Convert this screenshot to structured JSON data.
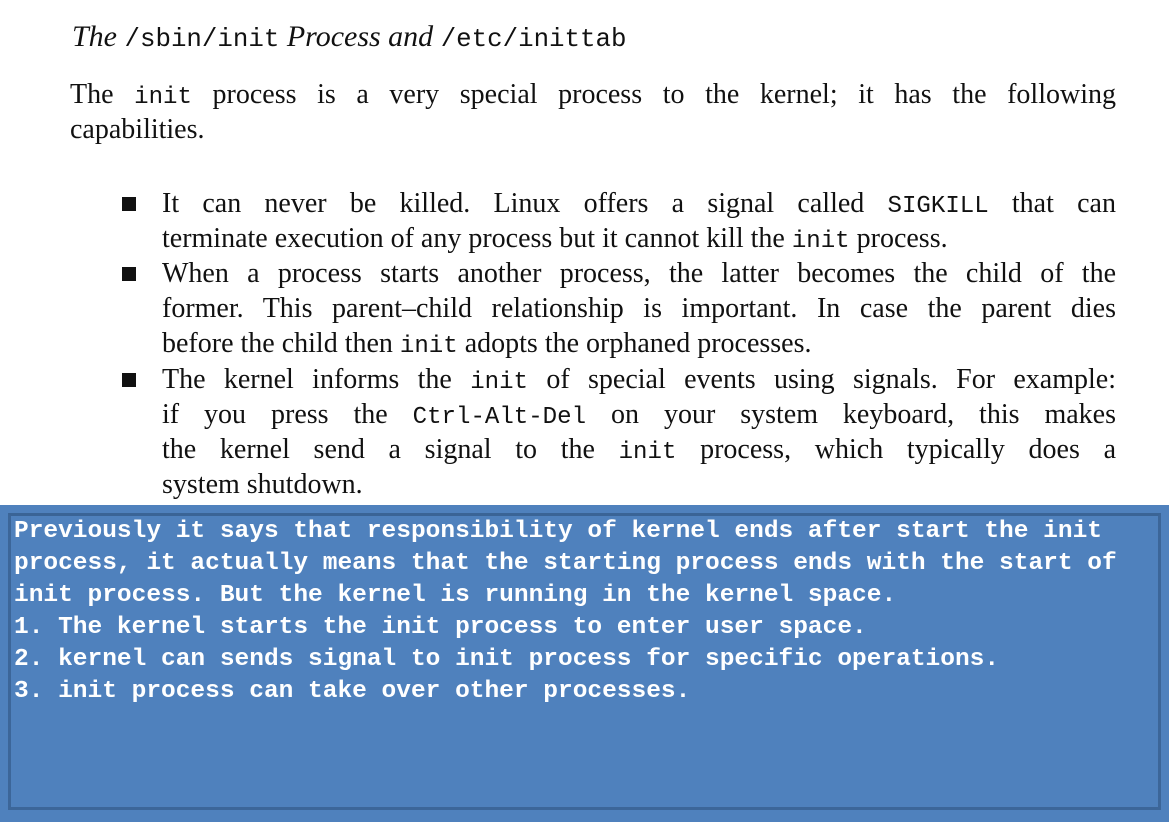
{
  "heading": [
    {
      "t": "The "
    },
    {
      "t": "/sbin/init",
      "code": true
    },
    {
      "t": " Process and "
    },
    {
      "t": "/etc/inittab",
      "code": true
    }
  ],
  "intro": [
    [
      {
        "t": "The "
      },
      {
        "t": "init",
        "code": true
      },
      {
        "t": " process is a very special process to the kernel; it has the following"
      }
    ],
    [
      {
        "t": "capabilities."
      }
    ]
  ],
  "bullets": [
    {
      "lines": [
        [
          {
            "t": "It can never be killed. Linux offers a signal called "
          },
          {
            "t": "SIGKILL",
            "code": true
          },
          {
            "t": " that can"
          }
        ],
        [
          {
            "t": "terminate execution of any process but it cannot kill the "
          },
          {
            "t": "init",
            "code": true
          },
          {
            "t": " process."
          }
        ]
      ]
    },
    {
      "lines": [
        [
          {
            "t": "When a process starts another process, the latter becomes the child of the"
          }
        ],
        [
          {
            "t": "former. This parent–child relationship is important. In case the parent dies"
          }
        ],
        [
          {
            "t": "before the child then "
          },
          {
            "t": "init",
            "code": true
          },
          {
            "t": " adopts the orphaned processes."
          }
        ]
      ]
    },
    {
      "lines": [
        [
          {
            "t": "The kernel informs the "
          },
          {
            "t": "init",
            "code": true
          },
          {
            "t": " of special events using signals. For example:"
          }
        ],
        [
          {
            "t": "if you press the "
          },
          {
            "t": "Ctrl-Alt-Del",
            "code": true
          },
          {
            "t": " on your system keyboard, this makes"
          }
        ],
        [
          {
            "t": "the kernel send a signal to the "
          },
          {
            "t": "init",
            "code": true
          },
          {
            "t": " process, which typically does a"
          }
        ],
        [
          {
            "t": "system shutdown."
          }
        ]
      ]
    }
  ],
  "note": {
    "lines": [
      "Previously it says that responsibility of kernel ends after start the init",
      "process, it actually means that the starting process ends with the start of",
      "init process. But the kernel is running in the kernel space.",
      "1. The kernel starts the init process to enter user space.",
      "2. kernel can sends signal to init process for specific operations.",
      "3. init process can take over other processes."
    ],
    "bg_color": "#4f81bd",
    "border_color": "#3a6496"
  }
}
